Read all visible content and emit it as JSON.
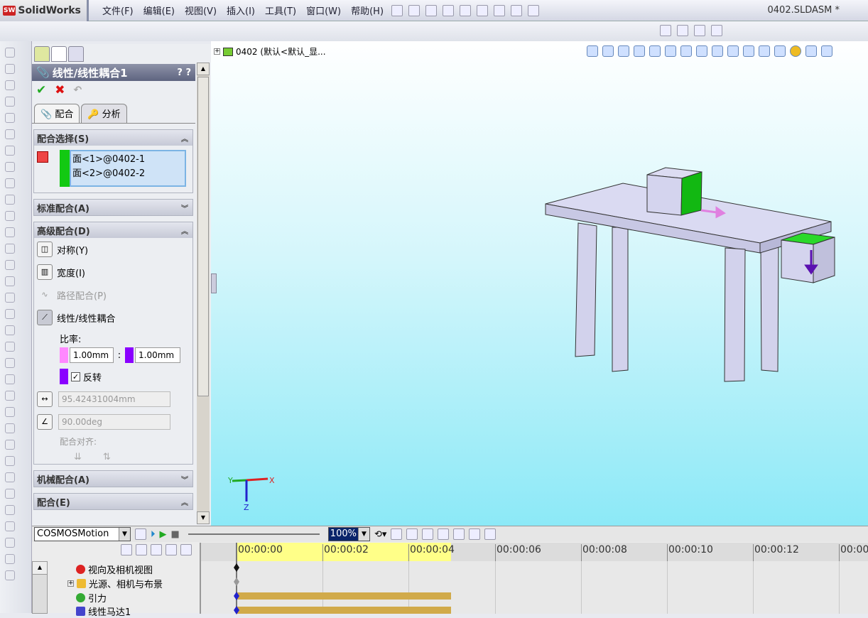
{
  "app": {
    "logo": "SolidWorks",
    "logo_badge": "SW",
    "title": "0402.SLDASM *"
  },
  "menu": [
    "文件(F)",
    "编辑(E)",
    "视图(V)",
    "插入(I)",
    "工具(T)",
    "窗口(W)",
    "帮助(H)"
  ],
  "panel": {
    "title": "线性/线性耦合1",
    "help": "? ?",
    "tabs": [
      "配合",
      "分析"
    ],
    "mate_selection": {
      "label": "配合选择(S)",
      "items": [
        "面<1>@0402-1",
        "面<2>@0402-2"
      ]
    },
    "standard": {
      "label": "标准配合(A)"
    },
    "advanced": {
      "label": "高级配合(D)",
      "options": [
        "对称(Y)",
        "宽度(I)",
        "路径配合(P)",
        "线性/线性耦合"
      ],
      "ratio_label": "比率:",
      "ratio_left": "1.00mm",
      "ratio_sep": ":",
      "ratio_right": "1.00mm",
      "reverse_label": "反转",
      "reverse_checked": true,
      "distance": "95.42431004mm",
      "angle": "90.00deg",
      "align_label": "配合对齐:"
    },
    "mechanical": {
      "label": "机械配合(A)"
    },
    "mates": {
      "label": "配合(E)"
    },
    "colors": {
      "ratio_left": "#ff88ff",
      "ratio_right": "#8a00ff",
      "selection": "#12c912"
    }
  },
  "viewport": {
    "tree_root": "0402  (默认<默认_显...",
    "axes": {
      "x": "X",
      "y": "Y",
      "z": "Z"
    }
  },
  "motion": {
    "study_type": "COSMOSMotion",
    "zoom": "100%",
    "ticks": [
      "00:00:00",
      "00:00:02",
      "00:00:04",
      "00:00:06",
      "00:00:08",
      "00:00:10",
      "00:00:12",
      "00:00"
    ],
    "tree": [
      "视向及相机视图",
      "光源、相机与布景",
      "引力",
      "线性马达1"
    ]
  }
}
